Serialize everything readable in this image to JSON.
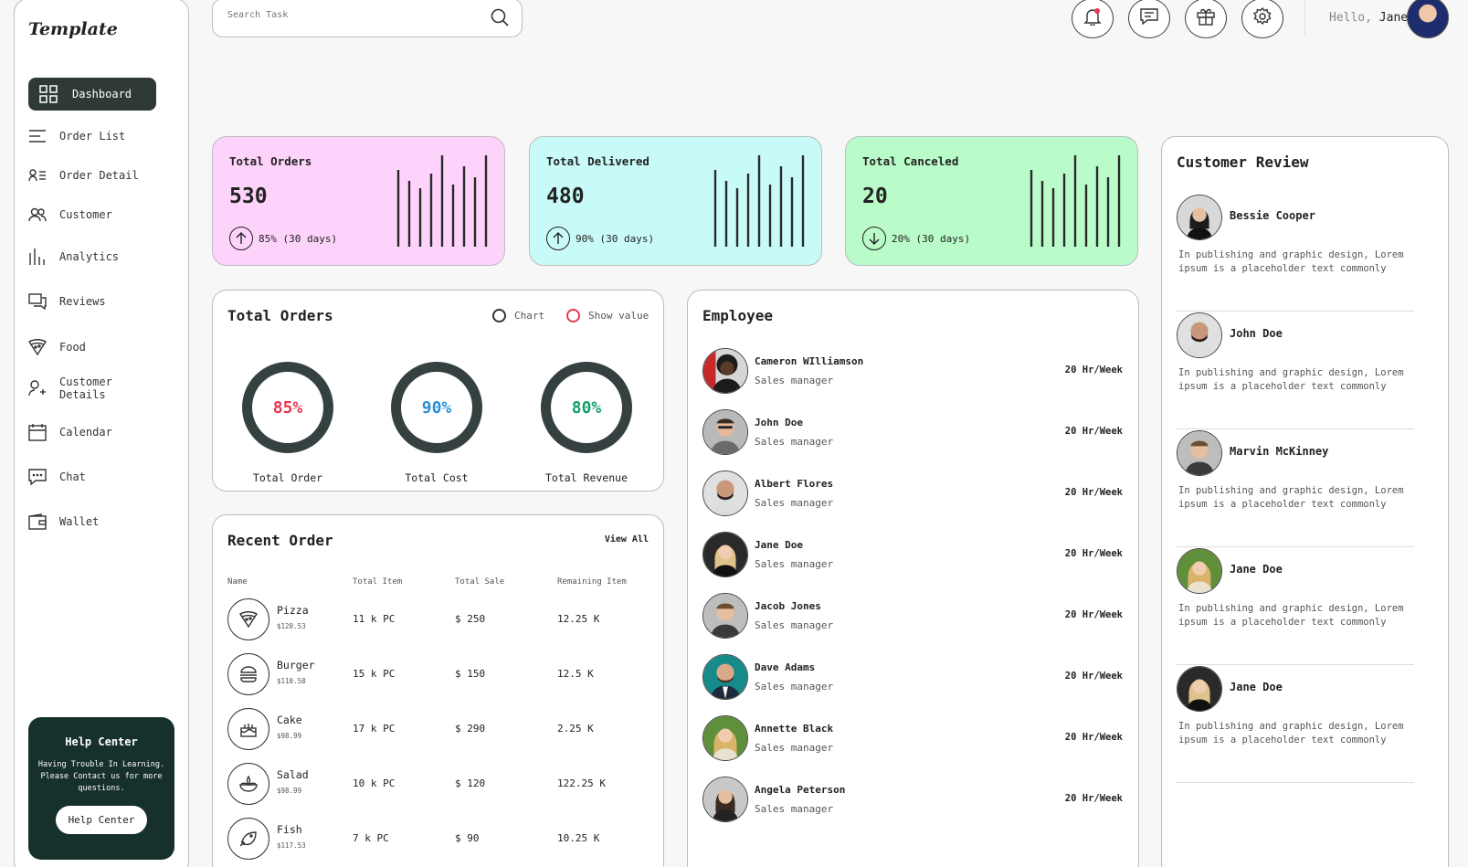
{
  "sidebar": {
    "logo": "Template",
    "items": [
      {
        "label": "Dashboard",
        "icon": "grid-icon"
      },
      {
        "label": "Order List",
        "icon": "list-icon"
      },
      {
        "label": "Order Detail",
        "icon": "user-list-icon"
      },
      {
        "label": "Customer",
        "icon": "users-icon"
      },
      {
        "label": "Analytics",
        "icon": "bar-chart-icon"
      },
      {
        "label": "Reviews",
        "icon": "chat-boxes-icon"
      },
      {
        "label": "Food",
        "icon": "pizza-icon"
      },
      {
        "label": "Customer Details",
        "icon": "user-plus-icon"
      },
      {
        "label": "Calendar",
        "icon": "calendar-icon"
      },
      {
        "label": "Chat",
        "icon": "chat-icon"
      },
      {
        "label": "Wallet",
        "icon": "wallet-icon"
      }
    ],
    "help": {
      "title": "Help Center",
      "text": "Having Trouble In Learning. Please Contact us for more questions.",
      "button": "Help Center"
    }
  },
  "header": {
    "search_placeholder": "Search Task",
    "greeting": "Hello,",
    "user_name": "Jane"
  },
  "stats": [
    {
      "title": "Total Orders",
      "value": "530",
      "trend": "85% (30 days)",
      "direction": "up",
      "color": "#fdd3fb"
    },
    {
      "title": "Total Delivered",
      "value": "480",
      "trend": "90% (30 days)",
      "direction": "up",
      "color": "#c8fbf7"
    },
    {
      "title": "Total Canceled",
      "value": "20",
      "trend": "20% (30 days)",
      "direction": "down",
      "color": "#b9fcc9"
    }
  ],
  "total_orders_panel": {
    "title": "Total Orders",
    "legend": [
      "Chart",
      "Show value"
    ],
    "rings": [
      {
        "value": "85%",
        "label": "Total Order",
        "color": "#e53950"
      },
      {
        "value": "90%",
        "label": "Total Cost",
        "color": "#2b8fd6"
      },
      {
        "value": "80%",
        "label": "Total Revenue",
        "color": "#13a06a"
      }
    ]
  },
  "recent_order": {
    "title": "Recent Order",
    "view_all": "View All",
    "columns": [
      "Name",
      "Total Item",
      "Total Sale",
      "Remaining Item"
    ],
    "rows": [
      {
        "name": "Pizza",
        "price": "$120.53",
        "items": "11 k PC",
        "sale": "$ 250",
        "remaining": "12.25 K",
        "icon": "pizza-icon"
      },
      {
        "name": "Burger",
        "price": "$110.58",
        "items": "15 k PC",
        "sale": "$ 150",
        "remaining": "12.5 K",
        "icon": "burger-icon"
      },
      {
        "name": "Cake",
        "price": "$98.99",
        "items": "17 k PC",
        "sale": "$ 290",
        "remaining": "2.25 K",
        "icon": "cake-icon"
      },
      {
        "name": "Salad",
        "price": "$98.99",
        "items": "10 k PC",
        "sale": "$ 120",
        "remaining": "122.25 K",
        "icon": "salad-icon"
      },
      {
        "name": "Fish",
        "price": "$117.53",
        "items": "7 k PC",
        "sale": "$ 90",
        "remaining": "10.25 K",
        "icon": "fish-icon"
      }
    ]
  },
  "employee": {
    "title": "Employee",
    "rows": [
      {
        "name": "Cameron WIlliamson",
        "role": "Sales manager",
        "hours": "20 Hr/Week"
      },
      {
        "name": "John Doe",
        "role": "Sales manager",
        "hours": "20 Hr/Week"
      },
      {
        "name": "Albert Flores",
        "role": "Sales manager",
        "hours": "20 Hr/Week"
      },
      {
        "name": "Jane Doe",
        "role": "Sales manager",
        "hours": "20 Hr/Week"
      },
      {
        "name": "Jacob Jones",
        "role": "Sales manager",
        "hours": "20 Hr/Week"
      },
      {
        "name": "Dave Adams",
        "role": "Sales manager",
        "hours": "20 Hr/Week"
      },
      {
        "name": "Annette Black",
        "role": "Sales manager",
        "hours": "20 Hr/Week"
      },
      {
        "name": "Angela Peterson",
        "role": "Sales manager",
        "hours": "20 Hr/Week"
      }
    ]
  },
  "reviews": {
    "title": "Customer Review",
    "rows": [
      {
        "name": "Bessie Cooper",
        "text": "In publishing and graphic design, Lorem ipsum is a placeholder text commonly"
      },
      {
        "name": "John Doe",
        "text": "In publishing and graphic design, Lorem ipsum is a placeholder text commonly"
      },
      {
        "name": "Marvin McKinney",
        "text": "In publishing and graphic design, Lorem ipsum is a placeholder text commonly"
      },
      {
        "name": "Jane Doe",
        "text": "In publishing and graphic design, Lorem ipsum is a placeholder text commonly"
      },
      {
        "name": "Jane Doe",
        "text": "In publishing and graphic design, Lorem ipsum is a placeholder text commonly"
      }
    ]
  }
}
